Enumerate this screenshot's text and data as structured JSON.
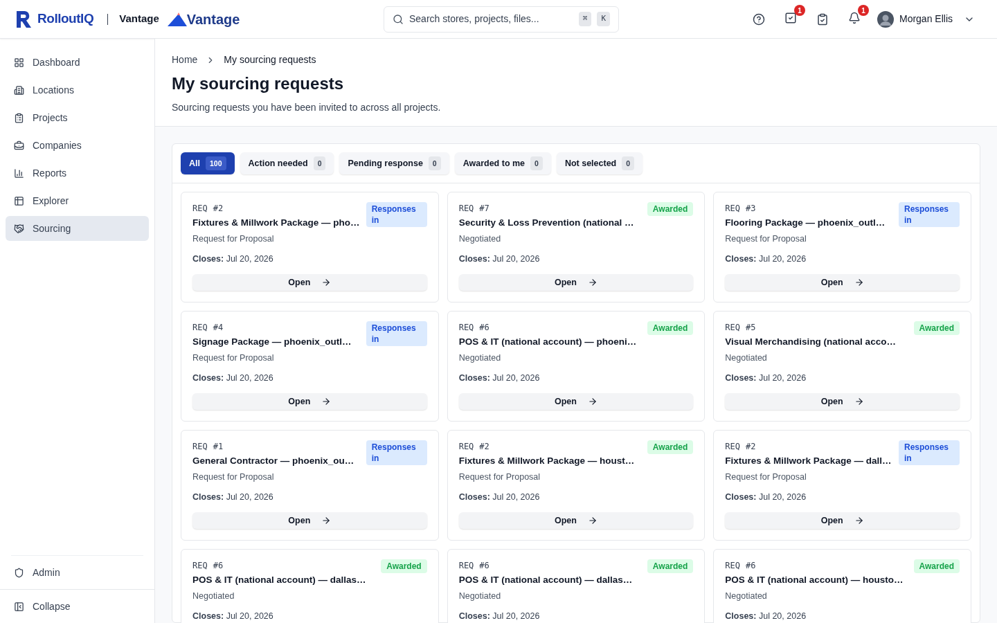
{
  "header": {
    "brand": "RolloutIQ",
    "workspace": "Vantage",
    "client_logo": "Vantage",
    "search": {
      "placeholder": "Search stores, projects, files...",
      "keys": [
        "⌘",
        "K"
      ]
    },
    "tasks_badge": "1",
    "notifications_badge": "1",
    "user": "Morgan Ellis"
  },
  "sidebar": {
    "items": [
      {
        "label": "Dashboard",
        "selected": false
      },
      {
        "label": "Locations",
        "selected": false
      },
      {
        "label": "Projects",
        "selected": false
      },
      {
        "label": "Companies",
        "selected": false
      },
      {
        "label": "Reports",
        "selected": false
      },
      {
        "label": "Explorer",
        "selected": false
      },
      {
        "label": "Sourcing",
        "selected": true
      }
    ],
    "admin": "Admin",
    "collapse": "Collapse"
  },
  "breadcrumb": [
    "Home",
    "My sourcing requests"
  ],
  "title": "My sourcing requests",
  "subtitle": "Sourcing requests you have been invited to across all projects.",
  "tabs": [
    {
      "label": "All",
      "count": "100",
      "selected": true
    },
    {
      "label": "Action needed",
      "count": "0",
      "selected": false
    },
    {
      "label": "Pending response",
      "count": "0",
      "selected": false
    },
    {
      "label": "Awarded to me",
      "count": "0",
      "selected": false
    },
    {
      "label": "Not selected",
      "count": "0",
      "selected": false
    }
  ],
  "cards": [
    {
      "req": "REQ",
      "num": "#2",
      "title": "Fixtures & Millwork Package — pho…",
      "type": "Request for Proposal",
      "status": {
        "kind": "responses",
        "label": "Responses in"
      },
      "closes_label": "Closes:",
      "closes": "Jul 20, 2026",
      "button": "Open"
    },
    {
      "req": "REQ",
      "num": "#7",
      "title": "Security & Loss Prevention (national …",
      "type": "Negotiated",
      "status": {
        "kind": "awarded",
        "label": "Awarded"
      },
      "closes_label": "Closes:",
      "closes": "Jul 20, 2026",
      "button": "Open"
    },
    {
      "req": "REQ",
      "num": "#3",
      "title": "Flooring Package — phoenix_outl…",
      "type": "Request for Proposal",
      "status": {
        "kind": "responses",
        "label": "Responses in"
      },
      "closes_label": "Closes:",
      "closes": "Jul 20, 2026",
      "button": "Open"
    },
    {
      "req": "REQ",
      "num": "#4",
      "title": "Signage Package — phoenix_outl…",
      "type": "Request for Proposal",
      "status": {
        "kind": "responses",
        "label": "Responses in"
      },
      "closes_label": "Closes:",
      "closes": "Jul 20, 2026",
      "button": "Open"
    },
    {
      "req": "REQ",
      "num": "#6",
      "title": "POS & IT (national account) — phoeni…",
      "type": "Negotiated",
      "status": {
        "kind": "awarded",
        "label": "Awarded"
      },
      "closes_label": "Closes:",
      "closes": "Jul 20, 2026",
      "button": "Open"
    },
    {
      "req": "REQ",
      "num": "#5",
      "title": "Visual Merchandising (national acco…",
      "type": "Negotiated",
      "status": {
        "kind": "awarded",
        "label": "Awarded"
      },
      "closes_label": "Closes:",
      "closes": "Jul 20, 2026",
      "button": "Open"
    },
    {
      "req": "REQ",
      "num": "#1",
      "title": "General Contractor — phoenix_ou…",
      "type": "Request for Proposal",
      "status": {
        "kind": "responses",
        "label": "Responses in"
      },
      "closes_label": "Closes:",
      "closes": "Jul 20, 2026",
      "button": "Open"
    },
    {
      "req": "REQ",
      "num": "#2",
      "title": "Fixtures & Millwork Package — houst…",
      "type": "Request for Proposal",
      "status": {
        "kind": "awarded",
        "label": "Awarded"
      },
      "closes_label": "Closes:",
      "closes": "Jul 20, 2026",
      "button": "Open"
    },
    {
      "req": "REQ",
      "num": "#2",
      "title": "Fixtures & Millwork Package — dall…",
      "type": "Request for Proposal",
      "status": {
        "kind": "responses",
        "label": "Responses in"
      },
      "closes_label": "Closes:",
      "closes": "Jul 20, 2026",
      "button": "Open"
    },
    {
      "req": "REQ",
      "num": "#6",
      "title": "POS & IT (national account) — dallas…",
      "type": "Negotiated",
      "status": {
        "kind": "awarded",
        "label": "Awarded"
      },
      "closes_label": "Closes:",
      "closes": "Jul 20, 2026"
    },
    {
      "req": "REQ",
      "num": "#6",
      "title": "POS & IT (national account) — dallas…",
      "type": "Negotiated",
      "status": {
        "kind": "awarded",
        "label": "Awarded"
      },
      "closes_label": "Closes:",
      "closes": "Jul 20, 2026"
    },
    {
      "req": "REQ",
      "num": "#6",
      "title": "POS & IT (national account) — housto…",
      "type": "Negotiated",
      "status": {
        "kind": "awarded",
        "label": "Awarded"
      },
      "closes_label": "Closes:",
      "closes": "Jul 20, 2026"
    }
  ]
}
